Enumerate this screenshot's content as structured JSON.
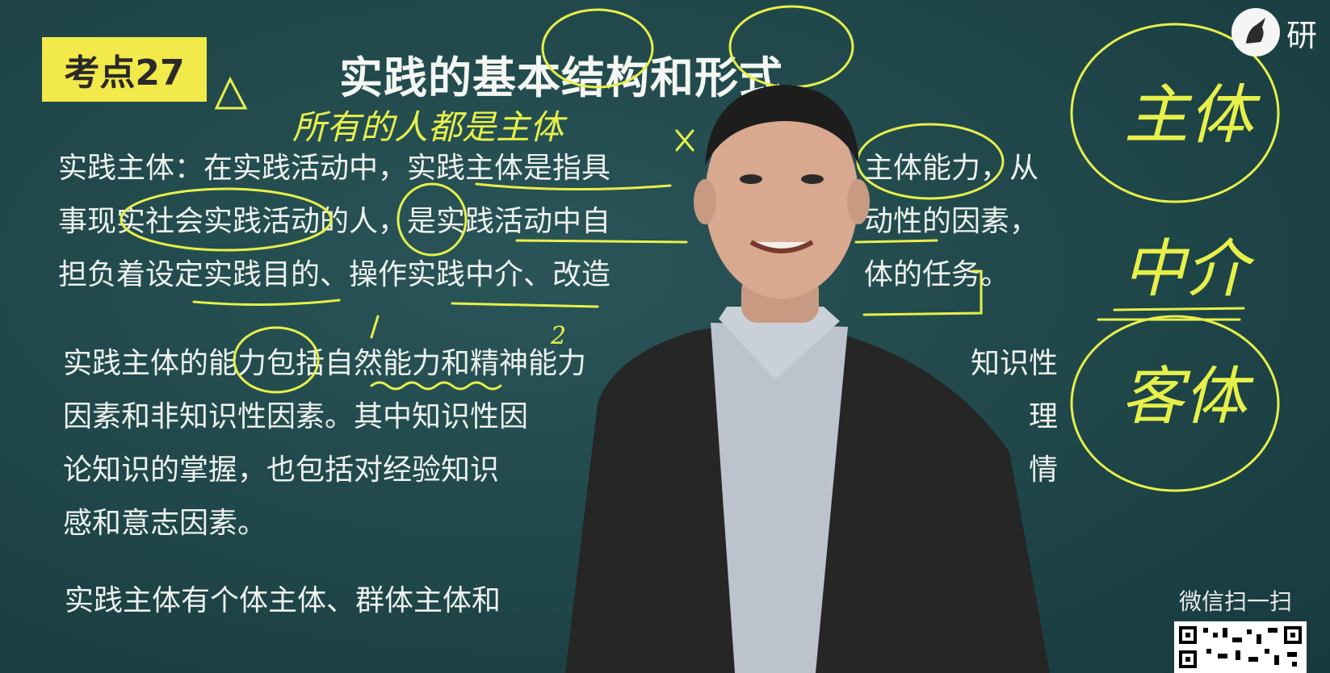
{
  "badge": "考点27",
  "title": "实践的基本结构和形式",
  "paragraphs": [
    {
      "lines": [
        "实践主体：在实践活动中，实践主体是指具",
        "事现实社会实践活动的人，是实践活动中自",
        "担负着设定实践目的、操作实践中介、改造"
      ],
      "right_fragments": [
        "主体能力，从",
        "动性的因素，",
        "体的任务。"
      ]
    },
    {
      "lines": [
        "实践主体的能力包括自然能力和精神能力",
        "因素和非知识性因素。其中知识性因",
        "论知识的掌握，也包括对经验知识",
        "感和意志因素。"
      ],
      "right_fragments": [
        "知识性",
        "理",
        "情"
      ]
    },
    {
      "lines": [
        "实践主体有个体主体、群体主体和"
      ]
    }
  ],
  "annotations": {
    "handwriting_top": "所有的人都是主体",
    "side_notes": [
      "主体",
      "中介",
      "客体"
    ],
    "numbers": [
      "1",
      "2"
    ],
    "marks": [
      "△",
      "×"
    ]
  },
  "watermark": {
    "text": "研"
  },
  "qr_section": {
    "label": "微信扫一扫"
  },
  "colors": {
    "board": "#1f4649",
    "badge": "#f2e94a",
    "ink": "#e7f04a",
    "text": "#eef2ee"
  }
}
